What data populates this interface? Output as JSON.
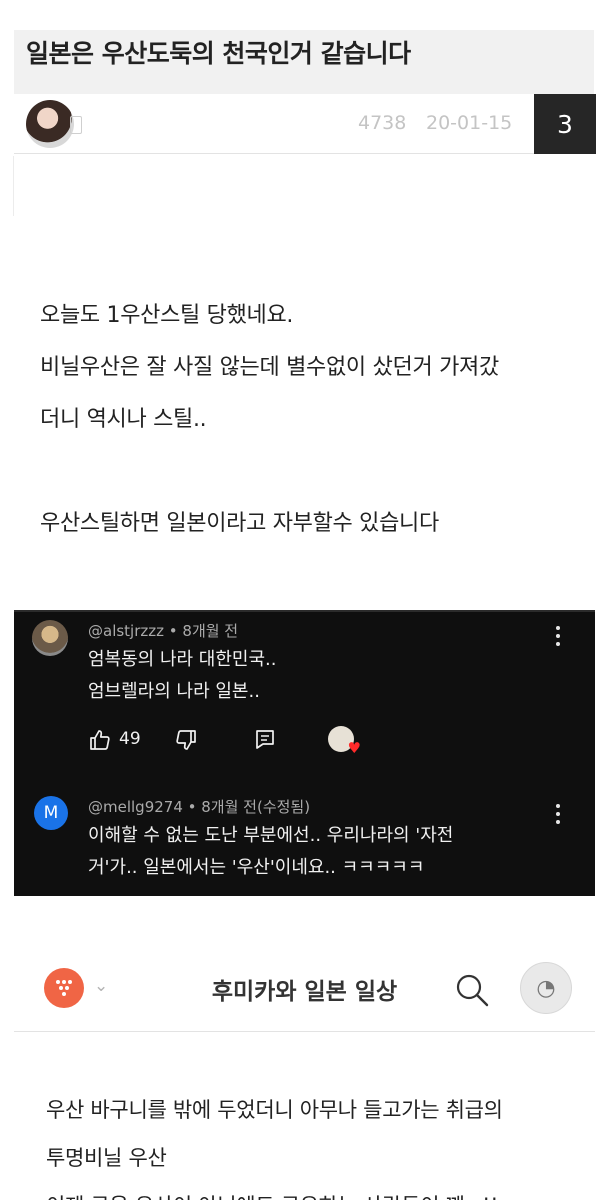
{
  "post": {
    "title": "일본은 우산도둑의 천국인거 같습니다",
    "views": "4738",
    "date": "20-01-15",
    "comment_count": "3",
    "body_lines": [
      "오늘도 1우산스틸 당했네요.",
      "비닐우산은 잘 사질 않는데 별수없이 샀던거 가져갔",
      "더니 역시나 스틸..",
      "",
      "우산스틸하면 일본이라고 자부할수 있습니다"
    ]
  },
  "youtube_comments": {
    "comment1": {
      "user": "@alstjrzzz • 8개월 전",
      "lines": [
        "엄복동의 나라 대한민국..",
        "엄브렐라의 나라 일본.."
      ],
      "likes": "49",
      "icons": [
        "thumbs-up-icon",
        "thumbs-down-icon",
        "reply-icon",
        "creator-heart-icon",
        "more-options-icon"
      ]
    },
    "comment2": {
      "user": "@mellg9274 • 8개월 전(수정됨)",
      "avatar_letter": "M",
      "lines": [
        "이해할 수 없는 도난 부분에선.. 우리나라의 '자전",
        "거'가.. 일본에서는 '우산'이네요.. ㅋㅋㅋㅋㅋ"
      ]
    }
  },
  "blog": {
    "title": "후미카와 일본 일상",
    "body_lines": [
      "우산 바구니를 밖에 두었더니 아무나 들고가는 취급의",
      "투명비닐 우산",
      "이제 공용 우산이 아님에도 공유하는 사람들이 꽤~!!"
    ],
    "accent": "#f06545"
  }
}
